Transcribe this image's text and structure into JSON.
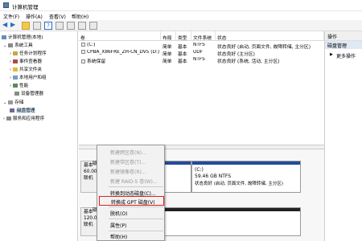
{
  "window": {
    "title": "计算机管理"
  },
  "menu": [
    "文件(F)",
    "操作(A)",
    "查看(V)",
    "帮助(H)"
  ],
  "tree": [
    {
      "label": "计算机管理(本地)",
      "level": 0
    },
    {
      "label": "系统工具",
      "level": 1
    },
    {
      "label": "任务计划程序",
      "level": 2
    },
    {
      "label": "事件查看器",
      "level": 2
    },
    {
      "label": "共享文件夹",
      "level": 2
    },
    {
      "label": "本地用户和组",
      "level": 2
    },
    {
      "label": "性能",
      "level": 2
    },
    {
      "label": "设备管理器",
      "level": 2
    },
    {
      "label": "存储",
      "level": 1
    },
    {
      "label": "磁盘管理",
      "level": 2,
      "selected": true
    },
    {
      "label": "服务和应用程序",
      "level": 1
    }
  ],
  "columns": [
    "卷",
    "布局",
    "类型",
    "文件系统",
    "状态"
  ],
  "volumes": [
    {
      "name": "(C:)",
      "layout": "简单",
      "type": "基本",
      "fs": "NTFS",
      "status": "状态良好 (启动, 页面文件, 故障转储, 主分区)"
    },
    {
      "name": "CPBA_X86FRE_ZH-CN_DV5 (D:)",
      "layout": "简单",
      "type": "基本",
      "fs": "UDF",
      "status": "状态良好 (主分区)"
    },
    {
      "name": "系统保留",
      "layout": "简单",
      "type": "基本",
      "fs": "NTFS",
      "status": "状态良好 (系统, 活动, 主分区)"
    }
  ],
  "disks": [
    {
      "lines": [
        "基本",
        "60.00",
        "联机"
      ]
    },
    {
      "lines": [
        "基本",
        "120.0",
        "联机"
      ]
    }
  ],
  "disk0_label": "磁",
  "disk1_label": "磁",
  "partition_c": {
    "name": "(C:)",
    "size": "59.46 GB NTFS",
    "status": "状态良好 (启动, 页面文件, 故障转储, 主分区)"
  },
  "actions": {
    "header": "操作",
    "section": "磁盘管理",
    "more": "更多操作"
  },
  "context_menu": [
    {
      "label": "新建跨区卷(N)...",
      "disabled": true
    },
    {
      "label": "新建带区卷(T)...",
      "disabled": true
    },
    {
      "label": "新建镜像卷(R)...",
      "disabled": true
    },
    {
      "label": "新建 RAID-5 卷(W)...",
      "disabled": true
    },
    {
      "label": "转换到动态磁盘(C)...",
      "disabled": false
    },
    {
      "label": "转换成 GPT 磁盘(V)",
      "disabled": false,
      "highlighted": true
    },
    {
      "label": "脱机(O)",
      "disabled": false
    },
    {
      "label": "属性(P)",
      "disabled": false
    },
    {
      "label": "帮助(H)",
      "disabled": false
    }
  ]
}
